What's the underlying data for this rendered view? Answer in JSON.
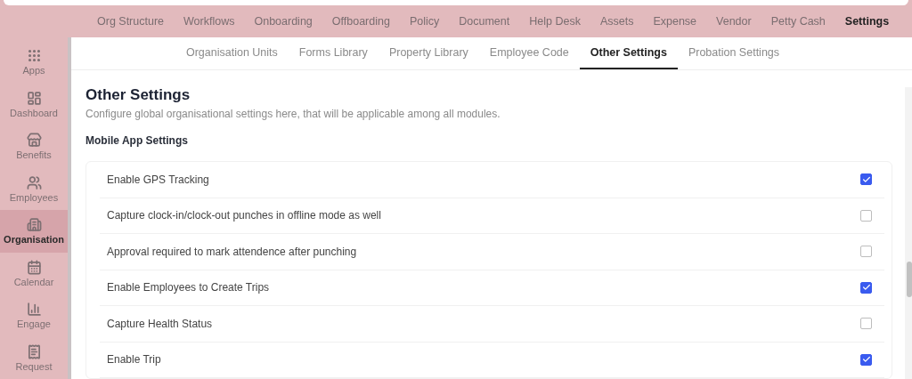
{
  "top_nav": [
    {
      "label": "Org Structure",
      "selected": false
    },
    {
      "label": "Workflows",
      "selected": false
    },
    {
      "label": "Onboarding",
      "selected": false
    },
    {
      "label": "Offboarding",
      "selected": false
    },
    {
      "label": "Policy",
      "selected": false
    },
    {
      "label": "Document",
      "selected": false
    },
    {
      "label": "Help Desk",
      "selected": false
    },
    {
      "label": "Assets",
      "selected": false
    },
    {
      "label": "Expense",
      "selected": false
    },
    {
      "label": "Vendor",
      "selected": false
    },
    {
      "label": "Petty Cash",
      "selected": false
    },
    {
      "label": "Settings",
      "selected": true
    }
  ],
  "sidebar": {
    "items": [
      {
        "label": "Apps",
        "kind": "apps",
        "selected": false
      },
      {
        "label": "Dashboard",
        "kind": "dashboard",
        "selected": false
      },
      {
        "label": "Benefits",
        "kind": "benefits",
        "selected": false
      },
      {
        "label": "Employees",
        "kind": "employees",
        "selected": false
      },
      {
        "label": "Organisation",
        "kind": "organisation",
        "selected": true
      },
      {
        "label": "Calendar",
        "kind": "calendar",
        "selected": false
      },
      {
        "label": "Engage",
        "kind": "engage",
        "selected": false
      },
      {
        "label": "Request",
        "kind": "request",
        "selected": false
      }
    ]
  },
  "tabs": [
    {
      "label": "Organisation Units",
      "selected": false
    },
    {
      "label": "Forms Library",
      "selected": false
    },
    {
      "label": "Property Library",
      "selected": false
    },
    {
      "label": "Employee Code",
      "selected": false
    },
    {
      "label": "Other Settings",
      "selected": true
    },
    {
      "label": "Probation Settings",
      "selected": false
    }
  ],
  "page": {
    "title": "Other Settings",
    "description": "Configure global organisational settings here, that will be applicable among all modules.",
    "section": "Mobile App Settings"
  },
  "settings": [
    {
      "label": "Enable GPS Tracking",
      "checked": true
    },
    {
      "label": "Capture clock-in/clock-out punches in offline mode as well",
      "checked": false
    },
    {
      "label": "Approval required to mark attendence after punching",
      "checked": false
    },
    {
      "label": "Enable Employees to Create Trips",
      "checked": true
    },
    {
      "label": "Capture Health Status",
      "checked": false
    },
    {
      "label": "Enable Trip",
      "checked": true
    }
  ]
}
